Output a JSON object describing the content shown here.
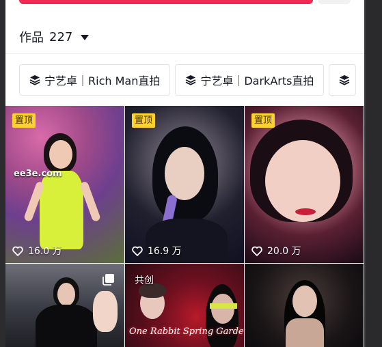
{
  "works_header": {
    "label": "作品",
    "count": "227"
  },
  "tags": [
    {
      "label": "宁艺卓｜Rich Man直拍"
    },
    {
      "label": "宁艺卓｜DarkArts直拍"
    }
  ],
  "videos": [
    {
      "pinned_label": "置顶",
      "watermark": "ee3e.com",
      "likes": "16.0 万"
    },
    {
      "pinned_label": "置顶",
      "likes": "16.9 万"
    },
    {
      "pinned_label": "置顶",
      "likes": "20.0 万"
    },
    {},
    {
      "co_create_label": "共创",
      "overlay_text": "One Rabbit Spring Garden Party"
    },
    {}
  ],
  "colors": {
    "accent": "#ee2a55",
    "pin_badge": "#fdd130"
  }
}
